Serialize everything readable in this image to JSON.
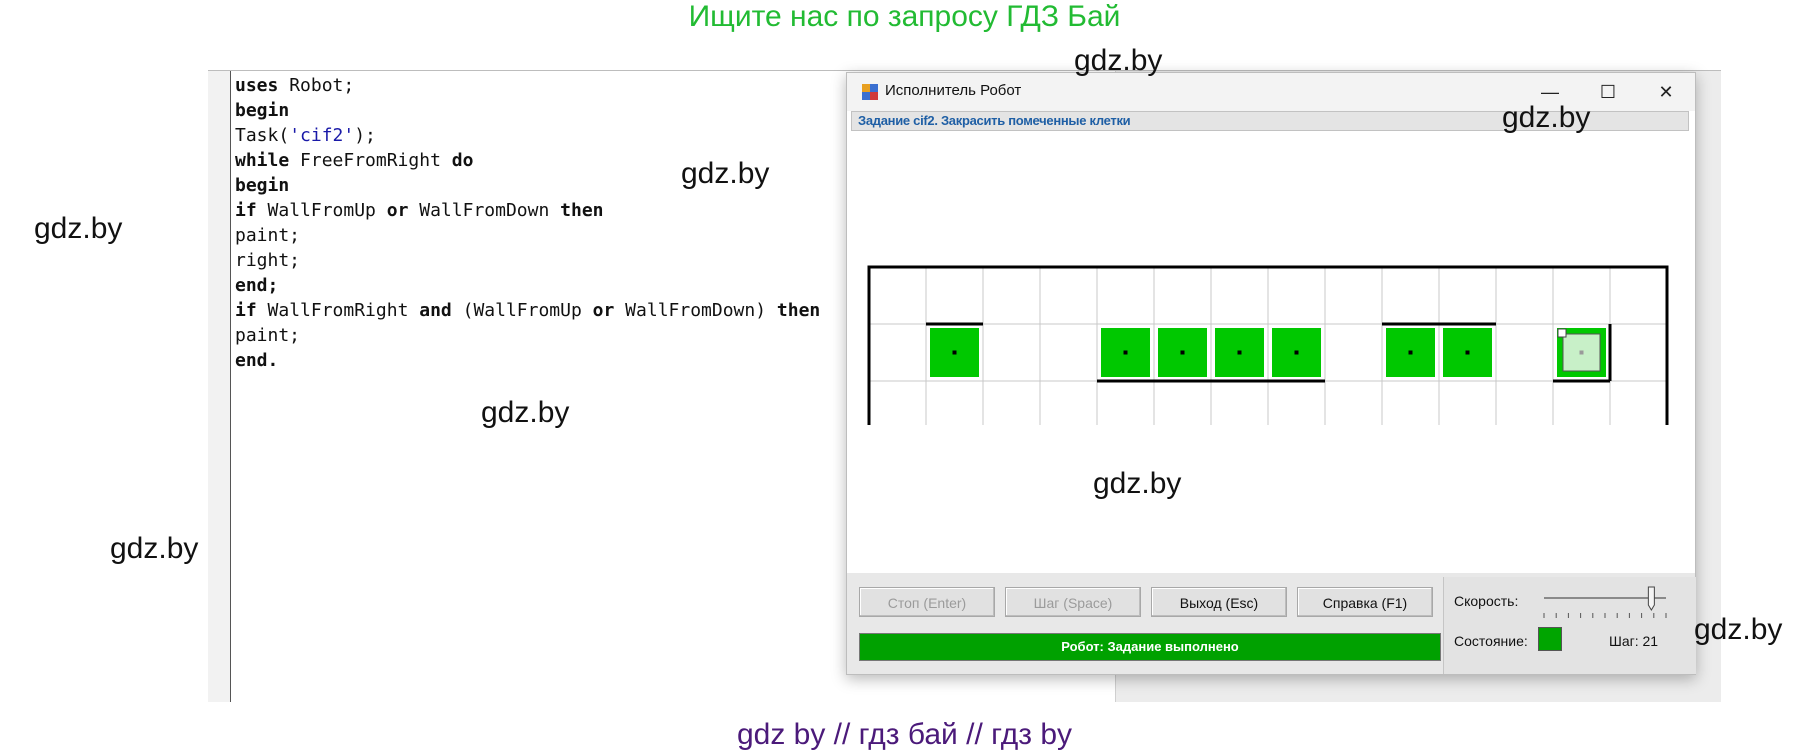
{
  "banners": {
    "top": "Ищите нас по запросу ГДЗ Бай",
    "bottom": "gdz by  //  гдз бай  //  гдз by"
  },
  "watermark": "gdz.by",
  "code_lines": [
    [
      {
        "t": "uses",
        "k": "kw"
      },
      {
        "t": " Robot;"
      }
    ],
    [
      {
        "t": "begin",
        "k": "kw"
      }
    ],
    [
      {
        "t": "Task("
      },
      {
        "t": "'cif2'",
        "k": "str"
      },
      {
        "t": ");"
      }
    ],
    [
      {
        "t": "while",
        "k": "kw"
      },
      {
        "t": " FreeFromRight "
      },
      {
        "t": "do",
        "k": "kw"
      }
    ],
    [
      {
        "t": "begin",
        "k": "kw"
      }
    ],
    [
      {
        "t": "if",
        "k": "kw"
      },
      {
        "t": " WallFromUp "
      },
      {
        "t": "or",
        "k": "kw"
      },
      {
        "t": " WallFromDown "
      },
      {
        "t": "then",
        "k": "kw"
      }
    ],
    [
      {
        "t": "paint;"
      }
    ],
    [
      {
        "t": "right;"
      }
    ],
    [
      {
        "t": "end;",
        "k": "kw"
      }
    ],
    [
      {
        "t": "if",
        "k": "kw"
      },
      {
        "t": " WallFromRight "
      },
      {
        "t": "and",
        "k": "kw"
      },
      {
        "t": " (WallFromUp "
      },
      {
        "t": "or",
        "k": "kw"
      },
      {
        "t": " WallFromDown) "
      },
      {
        "t": "then",
        "k": "kw"
      }
    ],
    [
      {
        "t": "paint;"
      }
    ],
    [
      {
        "t": "end.",
        "k": "kw"
      }
    ]
  ],
  "robot_window": {
    "title": "Исполнитель Робот",
    "task": "Задание cif2. Закрасить помеченные клетки",
    "buttons": {
      "stop": "Стоп (Enter)",
      "step": "Шаг (Space)",
      "exit": "Выход (Esc)",
      "help": "Справка (F1)"
    },
    "status": "Робот: Задание выполнено",
    "speed_label": "Скорость:",
    "state_label": "Состояние:",
    "step_counter": "Шаг: 21",
    "speed_fraction": 0.88
  },
  "field": {
    "rows": 3,
    "cols": 14,
    "painted": [
      [
        1,
        1
      ],
      [
        1,
        4
      ],
      [
        1,
        5
      ],
      [
        1,
        6
      ],
      [
        1,
        7
      ],
      [
        1,
        9
      ],
      [
        1,
        10
      ]
    ],
    "robot": [
      1,
      12
    ],
    "robot_cell_painted": true,
    "walls": [
      {
        "side": "top",
        "row": 1,
        "col": 1
      },
      {
        "side": "top",
        "row": 1,
        "col": 9
      },
      {
        "side": "top",
        "row": 1,
        "col": 10
      },
      {
        "side": "bottom",
        "row": 1,
        "col": 4
      },
      {
        "side": "bottom",
        "row": 1,
        "col": 5
      },
      {
        "side": "bottom",
        "row": 1,
        "col": 6
      },
      {
        "side": "bottom",
        "row": 1,
        "col": 7
      },
      {
        "side": "bottom",
        "row": 1,
        "col": 12
      },
      {
        "side": "right",
        "row": 1,
        "col": 12
      }
    ],
    "colors": {
      "painted": "#00c800",
      "robot_fill": "#c8f0c8",
      "grid": "#c8c8c8",
      "wall": "#000000"
    }
  }
}
